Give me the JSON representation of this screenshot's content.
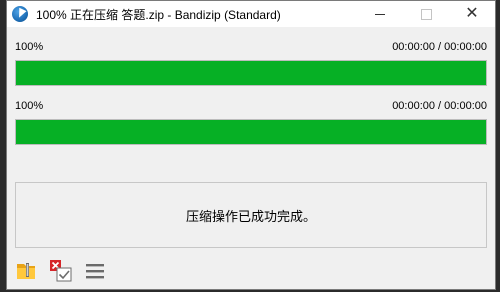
{
  "window": {
    "title": "100% 正在压缩 答题.zip - Bandizip (Standard)"
  },
  "progress": [
    {
      "percent_label": "100%",
      "time_label": "00:00:00 / 00:00:00",
      "fraction": 1.0
    },
    {
      "percent_label": "100%",
      "time_label": "00:00:00 / 00:00:00",
      "fraction": 1.0
    }
  ],
  "status": {
    "message": "压缩操作已成功完成。"
  },
  "toolbar": {
    "icons": [
      "open-folder-icon",
      "test-archive-icon",
      "menu-icon"
    ]
  },
  "colors": {
    "progress_fill": "#06b025",
    "window_bg": "#f0f0f0"
  }
}
